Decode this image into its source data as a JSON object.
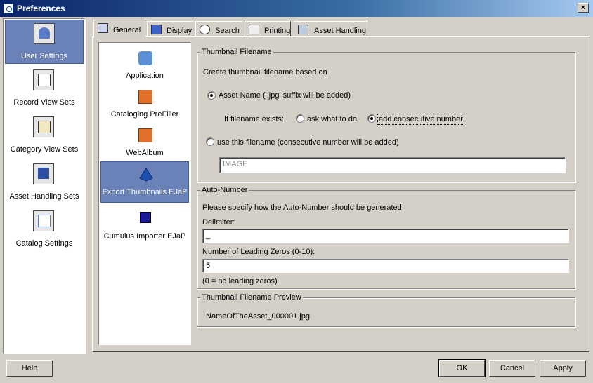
{
  "window": {
    "title": "Preferences",
    "close_glyph": "×"
  },
  "left_panel": {
    "items": [
      {
        "label": "User Settings",
        "selected": true,
        "icon": "user-icon"
      },
      {
        "label": "Record View Sets",
        "selected": false,
        "icon": "record-view-icon"
      },
      {
        "label": "Category View Sets",
        "selected": false,
        "icon": "category-view-icon"
      },
      {
        "label": "Asset Handling Sets",
        "selected": false,
        "icon": "asset-handling-icon"
      },
      {
        "label": "Catalog Settings",
        "selected": false,
        "icon": "catalog-settings-icon"
      }
    ]
  },
  "tabs": [
    {
      "label": "General",
      "active": true,
      "icon": "general-icon"
    },
    {
      "label": "Display",
      "active": false,
      "icon": "display-icon"
    },
    {
      "label": "Search",
      "active": false,
      "icon": "search-icon"
    },
    {
      "label": "Printing",
      "active": false,
      "icon": "printer-icon"
    },
    {
      "label": "Asset Handling",
      "active": false,
      "icon": "asset-handling-icon"
    }
  ],
  "sublist": {
    "items": [
      {
        "label": "Application",
        "selected": false,
        "icon": "application-icon"
      },
      {
        "label": "Cataloging PreFiller",
        "selected": false,
        "icon": "prefiller-icon"
      },
      {
        "label": "WebAlbum",
        "selected": false,
        "icon": "webalbum-icon"
      },
      {
        "label": "Export Thumbnails EJaP",
        "selected": true,
        "icon": "export-thumbnails-icon"
      },
      {
        "label": "Cumulus Importer EJaP",
        "selected": false,
        "icon": "importer-icon"
      }
    ]
  },
  "thumbnail_filename": {
    "title": "Thumbnail Filename",
    "intro": "Create thumbnail filename based on",
    "option_asset_name": "Asset Name ('.jpg' suffix will be added)",
    "if_exists_label": "If filename exists:",
    "option_ask": "ask what to do",
    "option_consecutive": "add consecutive number",
    "option_use_filename": "use this filename (consecutive number will be added)",
    "filename_value": "IMAGE"
  },
  "auto_number": {
    "title": "Auto-Number",
    "intro": "Please specify how the Auto-Number should be generated",
    "delimiter_label": "Delimiter:",
    "delimiter_value": "_",
    "zeros_label": "Number of Leading Zeros (0-10):",
    "zeros_value": "5",
    "zeros_hint": "(0 = no leading zeros)"
  },
  "preview": {
    "title": "Thumbnail Filename Preview",
    "value": "NameOfTheAsset_000001.jpg"
  },
  "buttons": {
    "help": "Help",
    "ok": "OK",
    "cancel": "Cancel",
    "apply": "Apply"
  }
}
